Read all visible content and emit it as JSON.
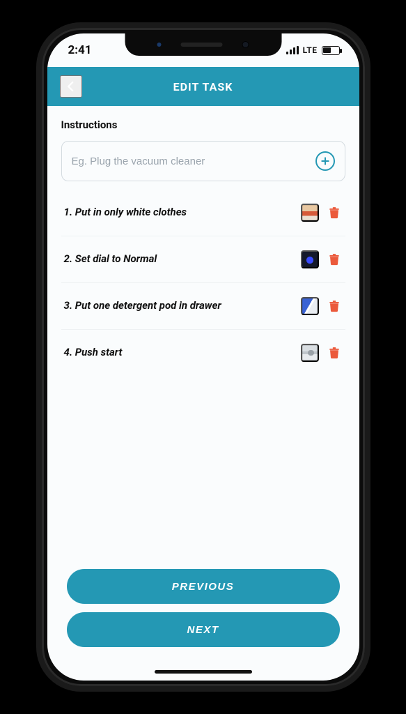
{
  "status": {
    "time": "2:41",
    "network_label": "LTE"
  },
  "nav": {
    "title": "EDIT TASK"
  },
  "section": {
    "label": "Instructions"
  },
  "input": {
    "placeholder": "Eg. Plug the vacuum cleaner",
    "value": ""
  },
  "instructions": [
    {
      "text": "1. Put in only white clothes",
      "thumb_name": "clothes-photo"
    },
    {
      "text": "2. Set dial to Normal",
      "thumb_name": "dial-photo"
    },
    {
      "text": "3. Put one detergent pod in drawer",
      "thumb_name": "detergent-photo"
    },
    {
      "text": "4. Push start",
      "thumb_name": "start-button-photo"
    }
  ],
  "buttons": {
    "previous": "PREVIOUS",
    "next": "NEXT"
  },
  "colors": {
    "accent": "#2498b4",
    "danger": "#eb5a3c"
  }
}
